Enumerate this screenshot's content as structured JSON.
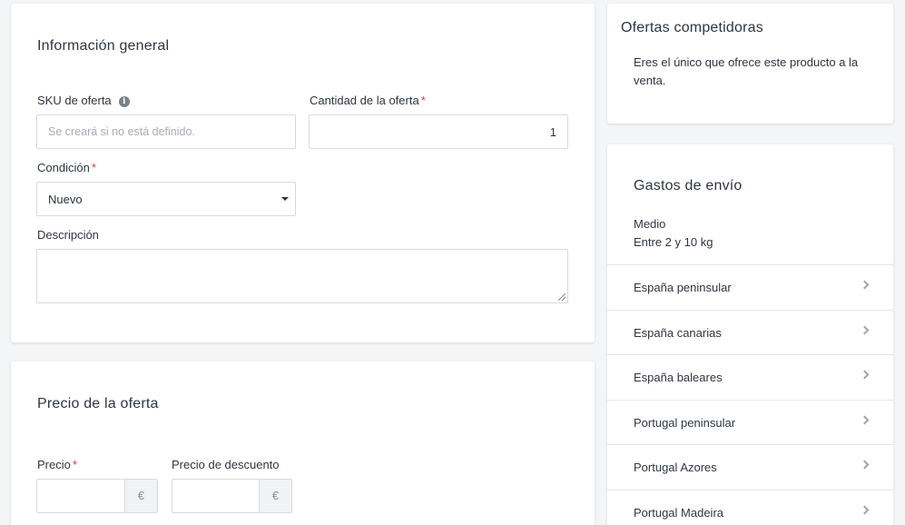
{
  "general": {
    "title": "Información general",
    "sku_label": "SKU de oferta",
    "sku_placeholder": "Se creará si no está definido.",
    "quantity_label": "Cantidad de la oferta",
    "quantity_value": "1",
    "condition_label": "Condición",
    "condition_value": "Nuevo",
    "description_label": "Descripción",
    "description_value": "",
    "required_mark": "*",
    "info_icon": "info-icon"
  },
  "price": {
    "title": "Precio de la oferta",
    "price_label": "Precio",
    "discount_label": "Precio de descuento",
    "currency": "€",
    "required_mark": "*"
  },
  "competitors": {
    "title": "Ofertas competidoras",
    "message": "Eres el único que ofrece este producto a la venta."
  },
  "shipping": {
    "title": "Gastos de envío",
    "size": "Medio",
    "weight_range": "Entre 2 y 10 kg",
    "regions": [
      {
        "label": "España peninsular"
      },
      {
        "label": "España canarias"
      },
      {
        "label": "España baleares"
      },
      {
        "label": "Portugal peninsular"
      },
      {
        "label": "Portugal Azores"
      },
      {
        "label": "Portugal Madeira"
      }
    ]
  },
  "colors": {
    "required": "#d93a3a",
    "background": "#f4f5f7",
    "text": "#2f3542"
  }
}
